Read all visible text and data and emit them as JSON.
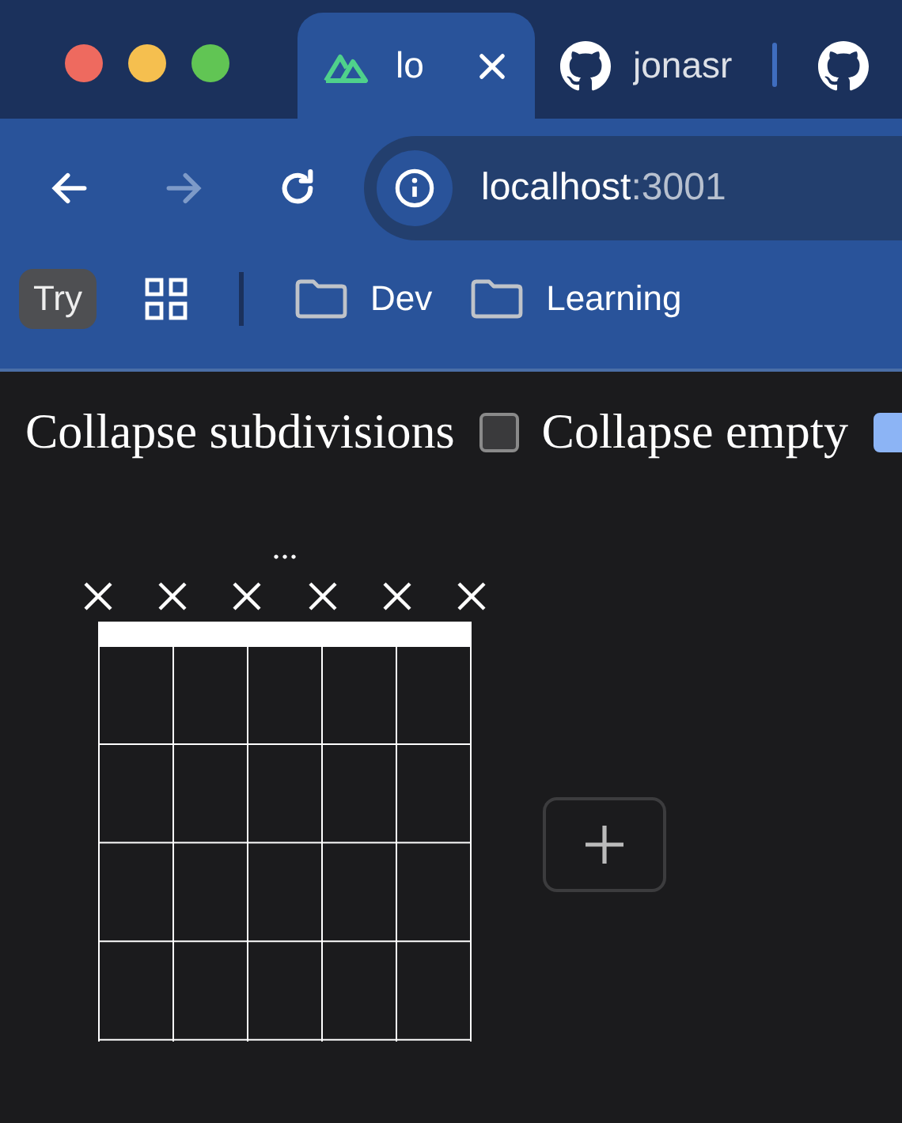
{
  "browser": {
    "tabs": [
      {
        "kind": "nuxt",
        "title": "lo",
        "selected": true
      },
      {
        "kind": "github",
        "title": "jonasr",
        "selected": false
      },
      {
        "kind": "github",
        "selected": false
      }
    ],
    "nav": {
      "back_disabled": false,
      "forward_disabled": true
    },
    "url": {
      "host": "localhost",
      "port": ":3001"
    },
    "bookmarks": [
      {
        "kind": "badge",
        "label": "Try"
      },
      {
        "kind": "apps"
      },
      {
        "kind": "folder",
        "label": "Dev"
      },
      {
        "kind": "folder",
        "label": "Learning"
      }
    ]
  },
  "options": [
    {
      "label": "Collapse subdivisions",
      "checked": false
    },
    {
      "label": "Collapse empty",
      "checked": true
    }
  ],
  "chord": {
    "name": "...",
    "strings": [
      {
        "muted": true
      },
      {
        "muted": true
      },
      {
        "muted": true
      },
      {
        "muted": true
      },
      {
        "muted": true
      },
      {
        "muted": true
      }
    ]
  }
}
